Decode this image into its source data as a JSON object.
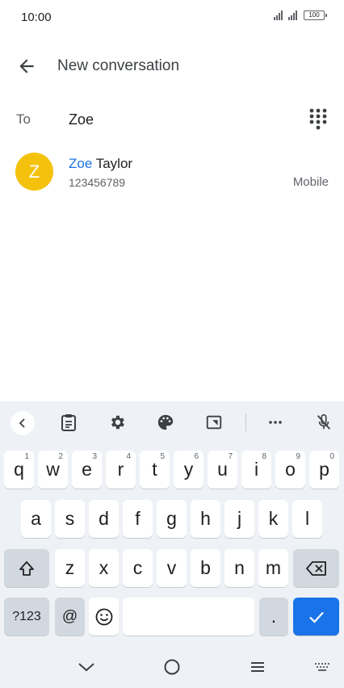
{
  "status_bar": {
    "time": "10:00",
    "battery_level": "100"
  },
  "app_bar": {
    "title": "New conversation"
  },
  "recipient": {
    "label": "To",
    "value": "Zoe"
  },
  "suggestions": [
    {
      "avatar_letter": "Z",
      "name_highlight": "Zoe",
      "name_rest": " Taylor",
      "number": "123456789",
      "type": "Mobile",
      "avatar_color": "#f4c20d"
    }
  ],
  "keyboard": {
    "row1": [
      {
        "label": "q",
        "hint": "1"
      },
      {
        "label": "w",
        "hint": "2"
      },
      {
        "label": "e",
        "hint": "3"
      },
      {
        "label": "r",
        "hint": "4"
      },
      {
        "label": "t",
        "hint": "5"
      },
      {
        "label": "y",
        "hint": "6"
      },
      {
        "label": "u",
        "hint": "7"
      },
      {
        "label": "i",
        "hint": "8"
      },
      {
        "label": "o",
        "hint": "9"
      },
      {
        "label": "p",
        "hint": "0"
      }
    ],
    "row2": [
      "a",
      "s",
      "d",
      "f",
      "g",
      "h",
      "j",
      "k",
      "l"
    ],
    "row3": [
      "z",
      "x",
      "c",
      "v",
      "b",
      "n",
      "m"
    ],
    "symbols_label": "?123",
    "at_label": "@",
    "period_label": ".",
    "space_label": ""
  },
  "colors": {
    "accent": "#1a73e8",
    "keyboard_bg": "#eef1f5",
    "special_key": "#d2d8df"
  }
}
